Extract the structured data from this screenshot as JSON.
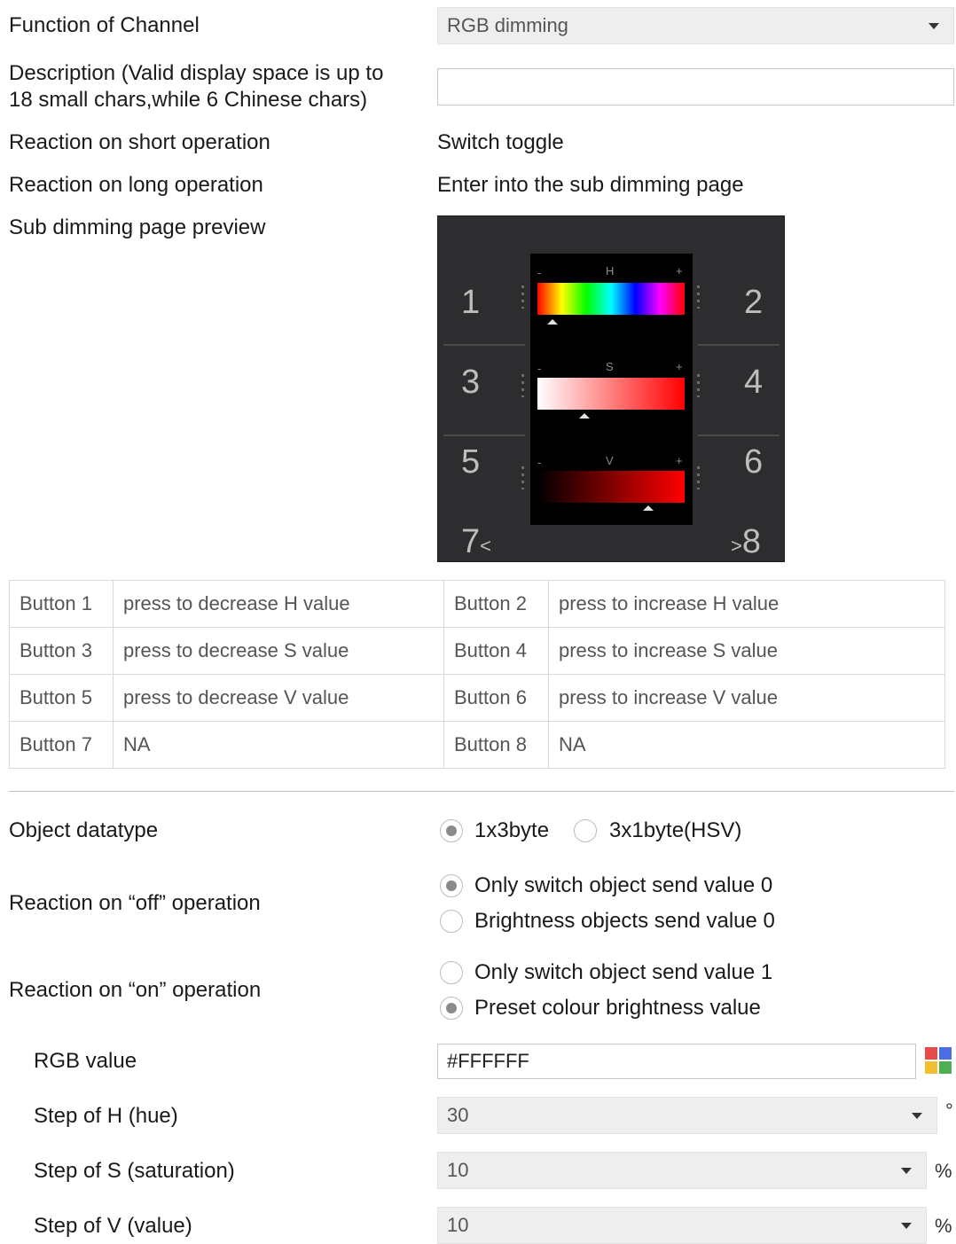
{
  "channel": {
    "function_label": "Function of Channel",
    "function_value": "RGB dimming",
    "description_label_line1": "Description (Valid display space is up to",
    "description_label_line2": "18 small chars,while 6 Chinese chars)",
    "description_value": "",
    "short_op_label": "Reaction on short operation",
    "short_op_value": "Switch toggle",
    "long_op_label": "Reaction on long operation",
    "long_op_value": "Enter into the sub dimming page",
    "preview_label": "Sub dimming page preview"
  },
  "preview": {
    "buttons": [
      "1",
      "2",
      "3",
      "4",
      "5",
      "6",
      "7",
      "8"
    ],
    "bars": [
      {
        "letter": "H",
        "minus": "-",
        "plus": "+",
        "level": 0.1
      },
      {
        "letter": "S",
        "minus": "-",
        "plus": "+",
        "level": 0.32
      },
      {
        "letter": "V",
        "minus": "-",
        "plus": "+",
        "level": 0.75
      }
    ],
    "hue_colors": [
      "#ff0000",
      "#ffff00",
      "#00ff00",
      "#00ffff",
      "#0000ff",
      "#ff00ff",
      "#ff0000"
    ],
    "sat_colors": [
      "#ffffff",
      "#ff0000"
    ],
    "val_colors": [
      "#000000",
      "#ff0000"
    ]
  },
  "button_table": [
    [
      "Button 1",
      "press to decrease H value",
      "Button 2",
      "press to increase H value"
    ],
    [
      "Button 3",
      "press to decrease S value",
      "Button 4",
      "press to increase S value"
    ],
    [
      "Button 5",
      "press to decrease V value",
      "Button 6",
      "press to increase V value"
    ],
    [
      "Button 7",
      "NA",
      "Button 8",
      "NA"
    ]
  ],
  "datatype": {
    "label": "Object datatype",
    "opt1": "1x3byte",
    "opt2": "3x1byte(HSV)",
    "selected": "1x3byte"
  },
  "off_reaction": {
    "label": "Reaction on “off” operation",
    "opt1": "Only switch object send value 0",
    "opt2": "Brightness objects send value 0",
    "selected": "Only switch object send value 0"
  },
  "on_reaction": {
    "label": "Reaction on “on” operation",
    "opt1": "Only switch object send value 1",
    "opt2": "Preset colour brightness value",
    "selected": "Preset colour brightness value"
  },
  "rgb": {
    "label": "RGB value",
    "value": "#FFFFFF"
  },
  "steps": {
    "h_label": "Step of H (hue)",
    "h_value": "30",
    "h_unit": "°",
    "s_label": "Step of S (saturation)",
    "s_value": "10",
    "s_unit": "%",
    "v_label": "Step of V (value)",
    "v_value": "10",
    "v_unit": "%"
  }
}
